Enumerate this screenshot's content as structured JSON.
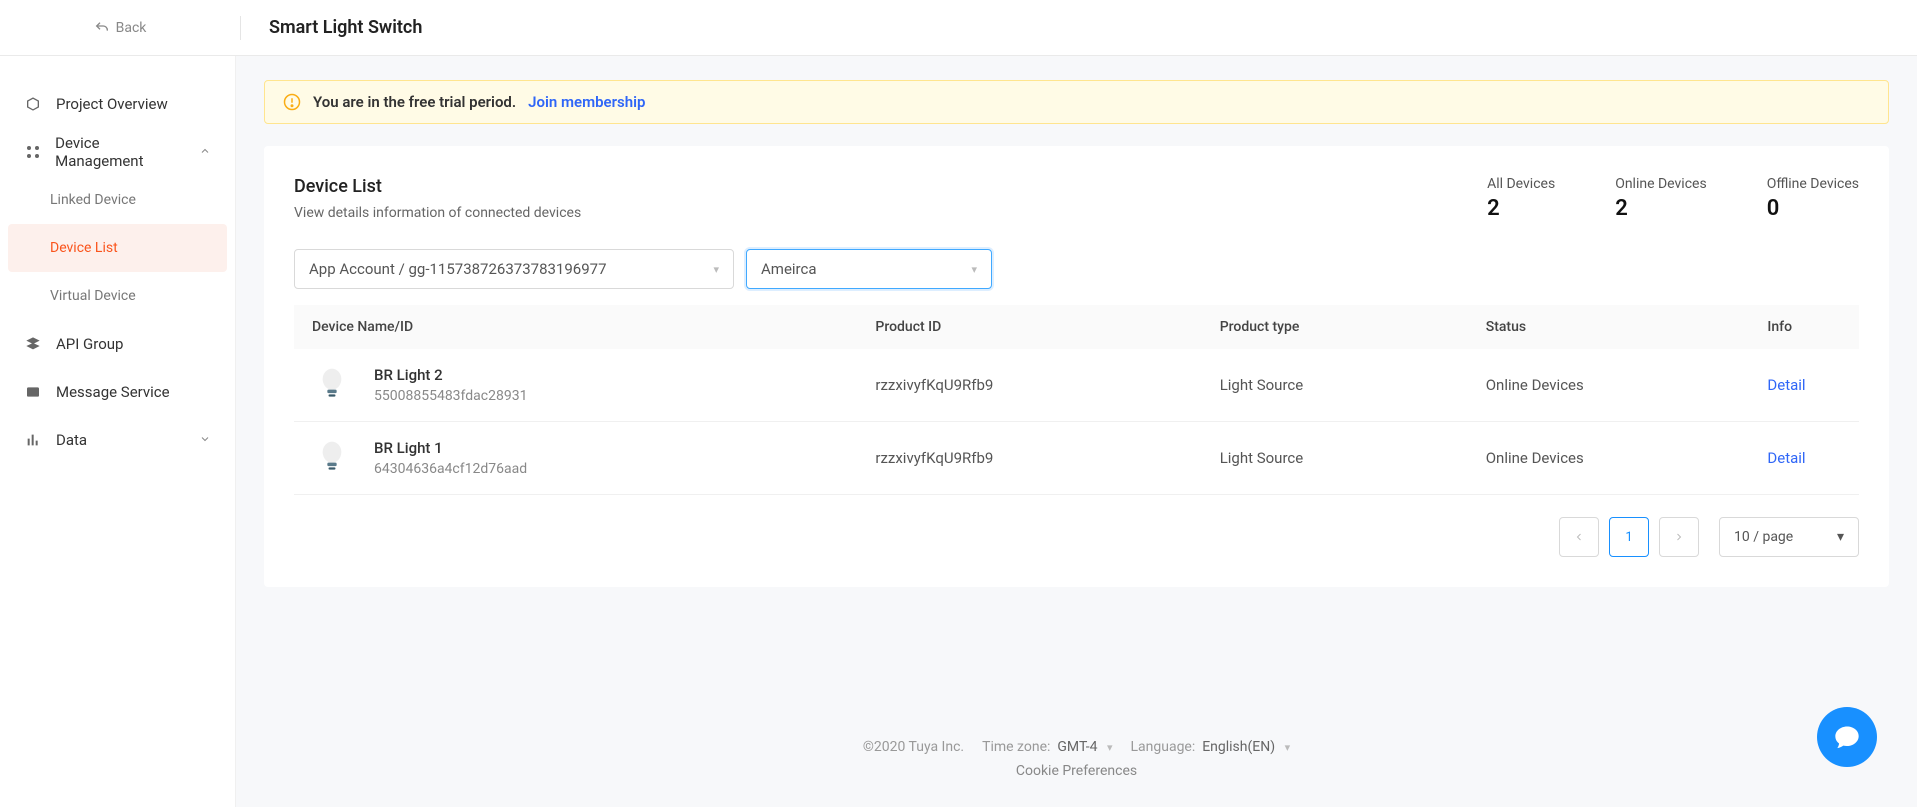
{
  "back_label": "Back",
  "page_title": "Smart Light Switch",
  "sidebar": {
    "project_overview": "Project Overview",
    "device_management": "Device Management",
    "linked_device": "Linked Device",
    "device_list": "Device List",
    "virtual_device": "Virtual Device",
    "api_group": "API Group",
    "message_service": "Message Service",
    "data": "Data"
  },
  "alert": {
    "text": "You are in the free trial period.",
    "link": "Join membership"
  },
  "card": {
    "title": "Device List",
    "subtitle": "View details information of connected devices"
  },
  "stats": {
    "all_label": "All Devices",
    "all_value": "2",
    "online_label": "Online Devices",
    "online_value": "2",
    "offline_label": "Offline Devices",
    "offline_value": "0"
  },
  "filters": {
    "account": "App Account / gg-115738726373783196977",
    "region": "Ameirca"
  },
  "columns": {
    "name": "Device Name/ID",
    "product_id": "Product ID",
    "product_type": "Product type",
    "status": "Status",
    "info": "Info"
  },
  "rows": [
    {
      "name": "BR Light 2",
      "id": "55008855483fdac28931",
      "product_id": "rzzxivyfKqU9Rfb9",
      "product_type": "Light Source",
      "status": "Online Devices",
      "info": "Detail"
    },
    {
      "name": "BR Light 1",
      "id": "64304636a4cf12d76aad",
      "product_id": "rzzxivyfKqU9Rfb9",
      "product_type": "Light Source",
      "status": "Online Devices",
      "info": "Detail"
    }
  ],
  "pagination": {
    "page": "1",
    "page_size": "10 / page"
  },
  "footer": {
    "copyright": "©2020 Tuya Inc.",
    "tz_label": "Time zone:",
    "tz_value": "GMT-4",
    "lang_label": "Language:",
    "lang_value": "English(EN)",
    "cookie": "Cookie Preferences"
  }
}
